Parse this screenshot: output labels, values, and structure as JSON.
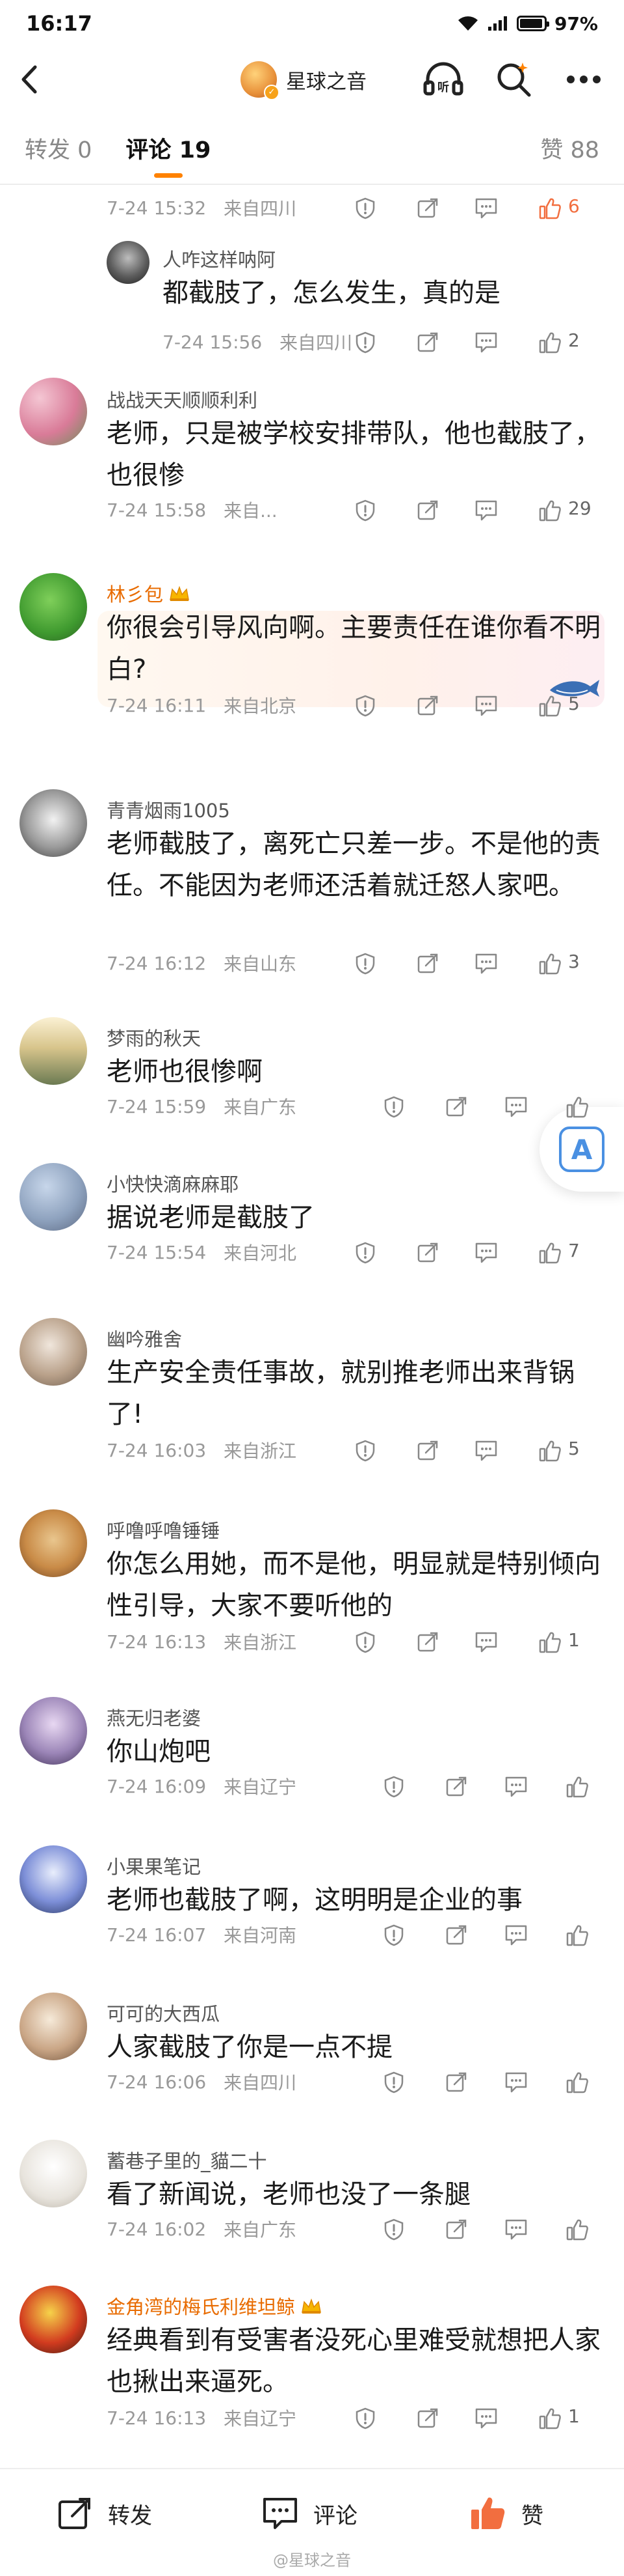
{
  "status": {
    "time": "16:17",
    "battery": "97%"
  },
  "nav": {
    "title": "星球之音"
  },
  "tabs": {
    "repost": "转发 0",
    "comments": "评论 19",
    "likes": "赞 88"
  },
  "top_reply_row": {
    "time": "7-24 15:32",
    "location": "来自四川",
    "likes": "6"
  },
  "reply": {
    "name": "人咋这样呐阿",
    "text": "都截肢了，怎么发生，真的是",
    "time": "7-24 15:56",
    "location": "来自四川",
    "likes": "2"
  },
  "comments": [
    {
      "name": "战战天天顺顺利利",
      "text": "老师，只是被学校安排带队，他也截肢了，也很惨",
      "time": "7-24 15:58",
      "location": "来自...",
      "likes": "29"
    },
    {
      "name": "林彡包",
      "text": "你很会引导风向啊。主要责任在谁你看不明白?",
      "time": "7-24 16:11",
      "location": "来自北京",
      "likes": "5"
    },
    {
      "name": "青青烟雨1005",
      "text": "老师截肢了，离死亡只差一步。不是他的责任。不能因为老师还活着就迁怒人家吧。",
      "time": "7-24 16:12",
      "location": "来自山东",
      "likes": "3"
    },
    {
      "name": "梦雨的秋天",
      "text": "老师也很惨啊",
      "time": "7-24 15:59",
      "location": "来自广东",
      "likes": ""
    },
    {
      "name": "小快快滴麻麻耶",
      "text": "据说老师是截肢了",
      "time": "7-24 15:54",
      "location": "来自河北",
      "likes": "7"
    },
    {
      "name": "幽吟雅舍",
      "text": "生产安全责任事故，就别推老师出来背锅了!",
      "time": "7-24 16:03",
      "location": "来自浙江",
      "likes": "5"
    },
    {
      "name": "呼噜呼噜锤锤",
      "text": "你怎么用她，而不是他，明显就是特别倾向性引导，大家不要听他的",
      "time": "7-24 16:13",
      "location": "来自浙江",
      "likes": "1"
    },
    {
      "name": "燕无归老婆",
      "text": "你山炮吧",
      "time": "7-24 16:09",
      "location": "来自辽宁",
      "likes": ""
    },
    {
      "name": "小果果笔记",
      "text": "老师也截肢了啊，这明明是企业的事",
      "time": "7-24 16:07",
      "location": "来自河南",
      "likes": ""
    },
    {
      "name": "可可的大西瓜",
      "text": "人家截肢了你是一点不提",
      "time": "7-24 16:06",
      "location": "来自四川",
      "likes": ""
    },
    {
      "name": "蓄巷子里的_貓二十",
      "text": "看了新闻说，老师也没了一条腿",
      "time": "7-24 16:02",
      "location": "来自广东",
      "likes": ""
    },
    {
      "name": "金角湾的梅氏利维坦鲸",
      "text": "经典看到有受害者没死心里难受就想把人家也揪出来逼死。",
      "time": "7-24 16:13",
      "location": "来自辽宁",
      "likes": "1"
    }
  ],
  "float_button": {
    "label": "A"
  },
  "bottom": {
    "repost": "转发",
    "comment": "评论",
    "like": "赞",
    "watermark": "@星球之音"
  },
  "colors": {
    "accent": "#ff8200",
    "vip_name": "#e86b00",
    "hot_like": "#f26e3f"
  }
}
